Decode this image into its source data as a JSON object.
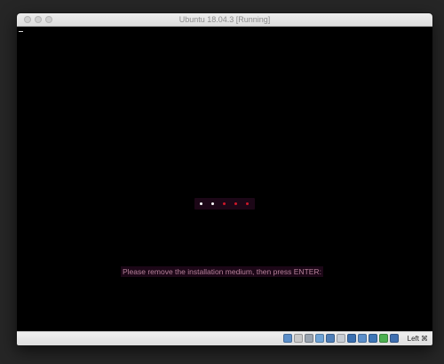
{
  "window": {
    "title": "Ubuntu 18.04.3 [Running]"
  },
  "screen": {
    "message": "Please remove the installation medium, then press ENTER:",
    "spinner_dots": [
      {
        "color": "#ffffff"
      },
      {
        "color": "#ffffff"
      },
      {
        "color": "#d0182a"
      },
      {
        "color": "#d0182a"
      },
      {
        "color": "#d0182a"
      }
    ]
  },
  "statusbar": {
    "icons": [
      {
        "name": "hard-disk-icon",
        "color": "#5b8ec9"
      },
      {
        "name": "optical-drive-icon",
        "color": "#c9c9c9"
      },
      {
        "name": "audio-icon",
        "color": "#9aa4b0"
      },
      {
        "name": "network-icon",
        "color": "#6ea3d6"
      },
      {
        "name": "usb-icon",
        "color": "#4f7fb8"
      },
      {
        "name": "shared-folders-icon",
        "color": "#c8cdd4"
      },
      {
        "name": "display-icon",
        "color": "#3a6fb0"
      },
      {
        "name": "video-capture-icon",
        "color": "#5b8ec9"
      },
      {
        "name": "mouse-integration-icon",
        "color": "#3d75b6"
      },
      {
        "name": "cpu-icon",
        "color": "#4caf50"
      },
      {
        "name": "keyboard-icon",
        "color": "#3f6fb0"
      }
    ],
    "host_key_label": "Left",
    "host_key_symbol": "⌘"
  }
}
